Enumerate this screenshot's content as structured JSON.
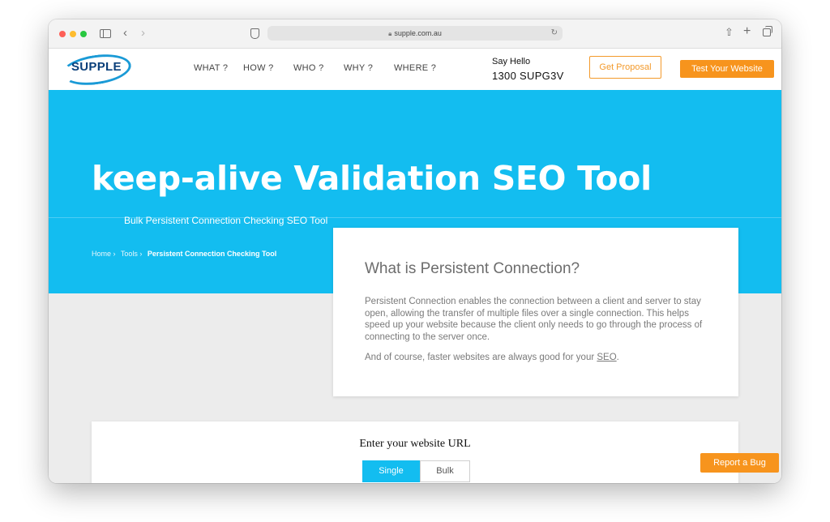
{
  "browser": {
    "url": "supple.com.au"
  },
  "header": {
    "logo_text": "SUPPLE",
    "nav": [
      "WHAT ?",
      "HOW ?",
      "WHO ?",
      "WHY ?",
      "WHERE ?"
    ],
    "say_hello": "Say Hello",
    "phone": "1300 SUPG3V",
    "proposal_label": "Get Proposal",
    "test_label": "Test Your Website"
  },
  "hero": {
    "title": "keep-alive Validation SEO Tool",
    "subtitle": "Bulk Persistent Connection Checking SEO Tool",
    "breadcrumb": [
      "Home",
      "Tools",
      "Persistent Connection Checking Tool"
    ],
    "breadcrumb_sep": "›"
  },
  "info": {
    "title": "What is Persistent Connection?",
    "paragraph1": "Persistent Connection enables the connection between a client and server to stay open, allowing the transfer of multiple files over a single connection. This helps speed up your website because the client only needs to go through the process of connecting to the server once.",
    "paragraph2_prefix": "And of course, faster websites are always good for your ",
    "paragraph2_link": "SEO",
    "paragraph2_suffix": "."
  },
  "form": {
    "title": "Enter your website URL",
    "tab_single": "Single",
    "tab_bulk": "Bulk"
  },
  "report_bug_label": "Report a Bug",
  "colors": {
    "hero_blue": "#13bdf0",
    "accent_orange": "#f7941d",
    "logo_navy": "#0a3f7a"
  }
}
